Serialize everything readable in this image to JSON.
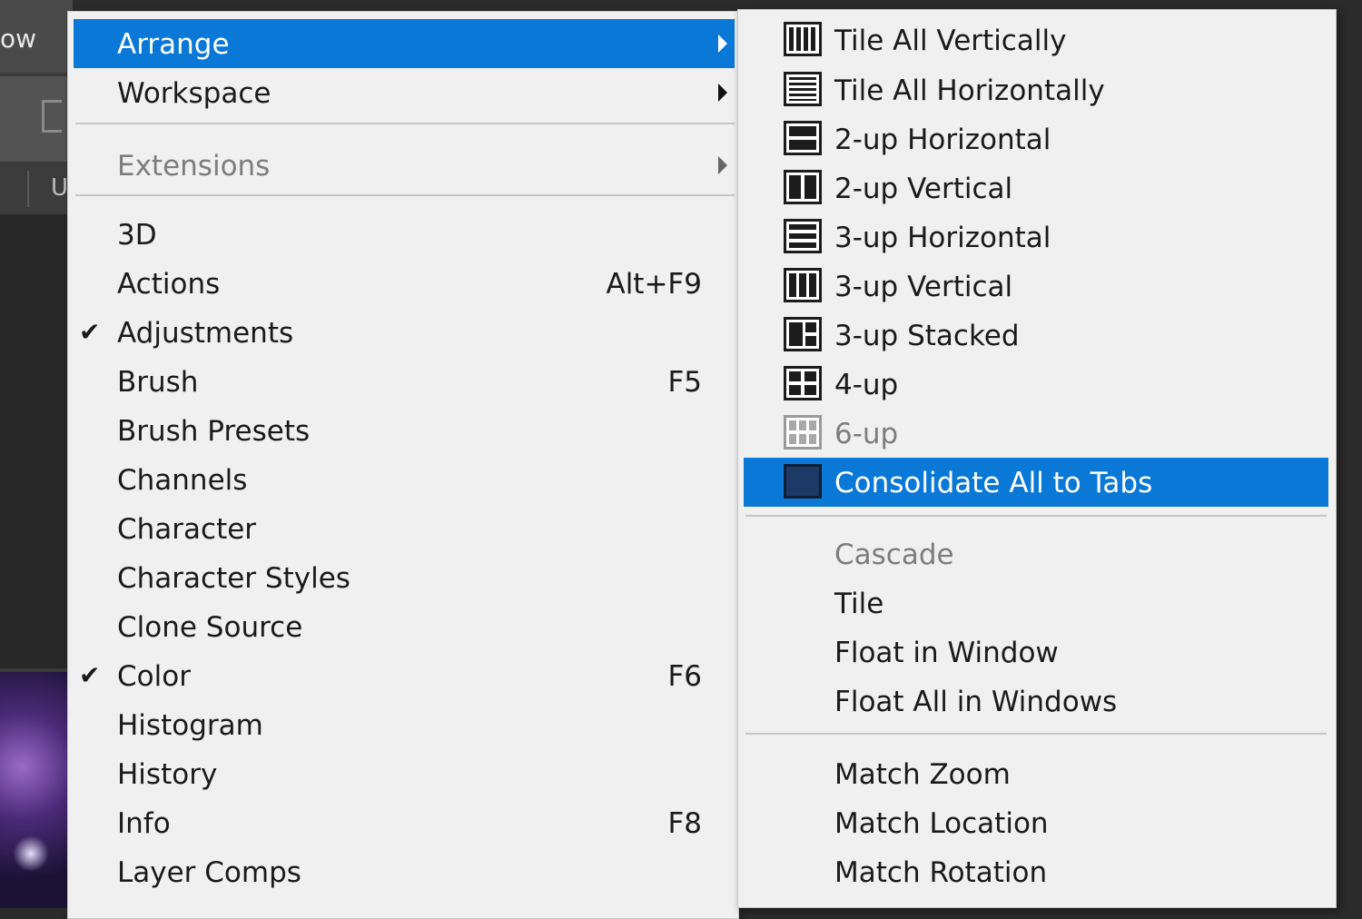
{
  "app": {
    "menubar_label": "ow",
    "tab_label": "U"
  },
  "menu": {
    "items": [
      {
        "label": "Arrange",
        "submenu": true,
        "highlighted": true
      },
      {
        "label": "Workspace",
        "submenu": true
      },
      {
        "separator": true
      },
      {
        "label": "Extensions",
        "submenu": true,
        "disabled": true
      },
      {
        "separator": true
      },
      {
        "label": "3D"
      },
      {
        "label": "Actions",
        "shortcut": "Alt+F9"
      },
      {
        "label": "Adjustments",
        "checked": true
      },
      {
        "label": "Brush",
        "shortcut": "F5"
      },
      {
        "label": "Brush Presets"
      },
      {
        "label": "Channels"
      },
      {
        "label": "Character"
      },
      {
        "label": "Character Styles"
      },
      {
        "label": "Clone Source"
      },
      {
        "label": "Color",
        "shortcut": "F6",
        "checked": true
      },
      {
        "label": "Histogram"
      },
      {
        "label": "History"
      },
      {
        "label": "Info",
        "shortcut": "F8"
      },
      {
        "label": "Layer Comps"
      }
    ],
    "check_glyph": "✔"
  },
  "submenu": {
    "items": [
      {
        "label": "Tile All Vertically",
        "icon": "tile-all-vertically-icon"
      },
      {
        "label": "Tile All Horizontally",
        "icon": "tile-all-horizontally-icon"
      },
      {
        "label": "2-up Horizontal",
        "icon": "two-up-horizontal-icon"
      },
      {
        "label": "2-up Vertical",
        "icon": "two-up-vertical-icon"
      },
      {
        "label": "3-up Horizontal",
        "icon": "three-up-horizontal-icon"
      },
      {
        "label": "3-up Vertical",
        "icon": "three-up-vertical-icon"
      },
      {
        "label": "3-up Stacked",
        "icon": "three-up-stacked-icon"
      },
      {
        "label": "4-up",
        "icon": "four-up-icon"
      },
      {
        "label": "6-up",
        "icon": "six-up-icon",
        "disabled": true
      },
      {
        "label": "Consolidate All to Tabs",
        "icon": "consolidate-tabs-icon",
        "highlighted": true
      },
      {
        "separator": true
      },
      {
        "label": "Cascade",
        "disabled": true
      },
      {
        "label": "Tile"
      },
      {
        "label": "Float in Window"
      },
      {
        "label": "Float All in Windows"
      },
      {
        "separator": true
      },
      {
        "label": "Match Zoom"
      },
      {
        "label": "Match Location"
      },
      {
        "label": "Match Rotation"
      }
    ]
  },
  "colors": {
    "highlight": "#0a78d7",
    "menu_bg": "#f0f0f0",
    "disabled_text": "#7d7d7d"
  }
}
